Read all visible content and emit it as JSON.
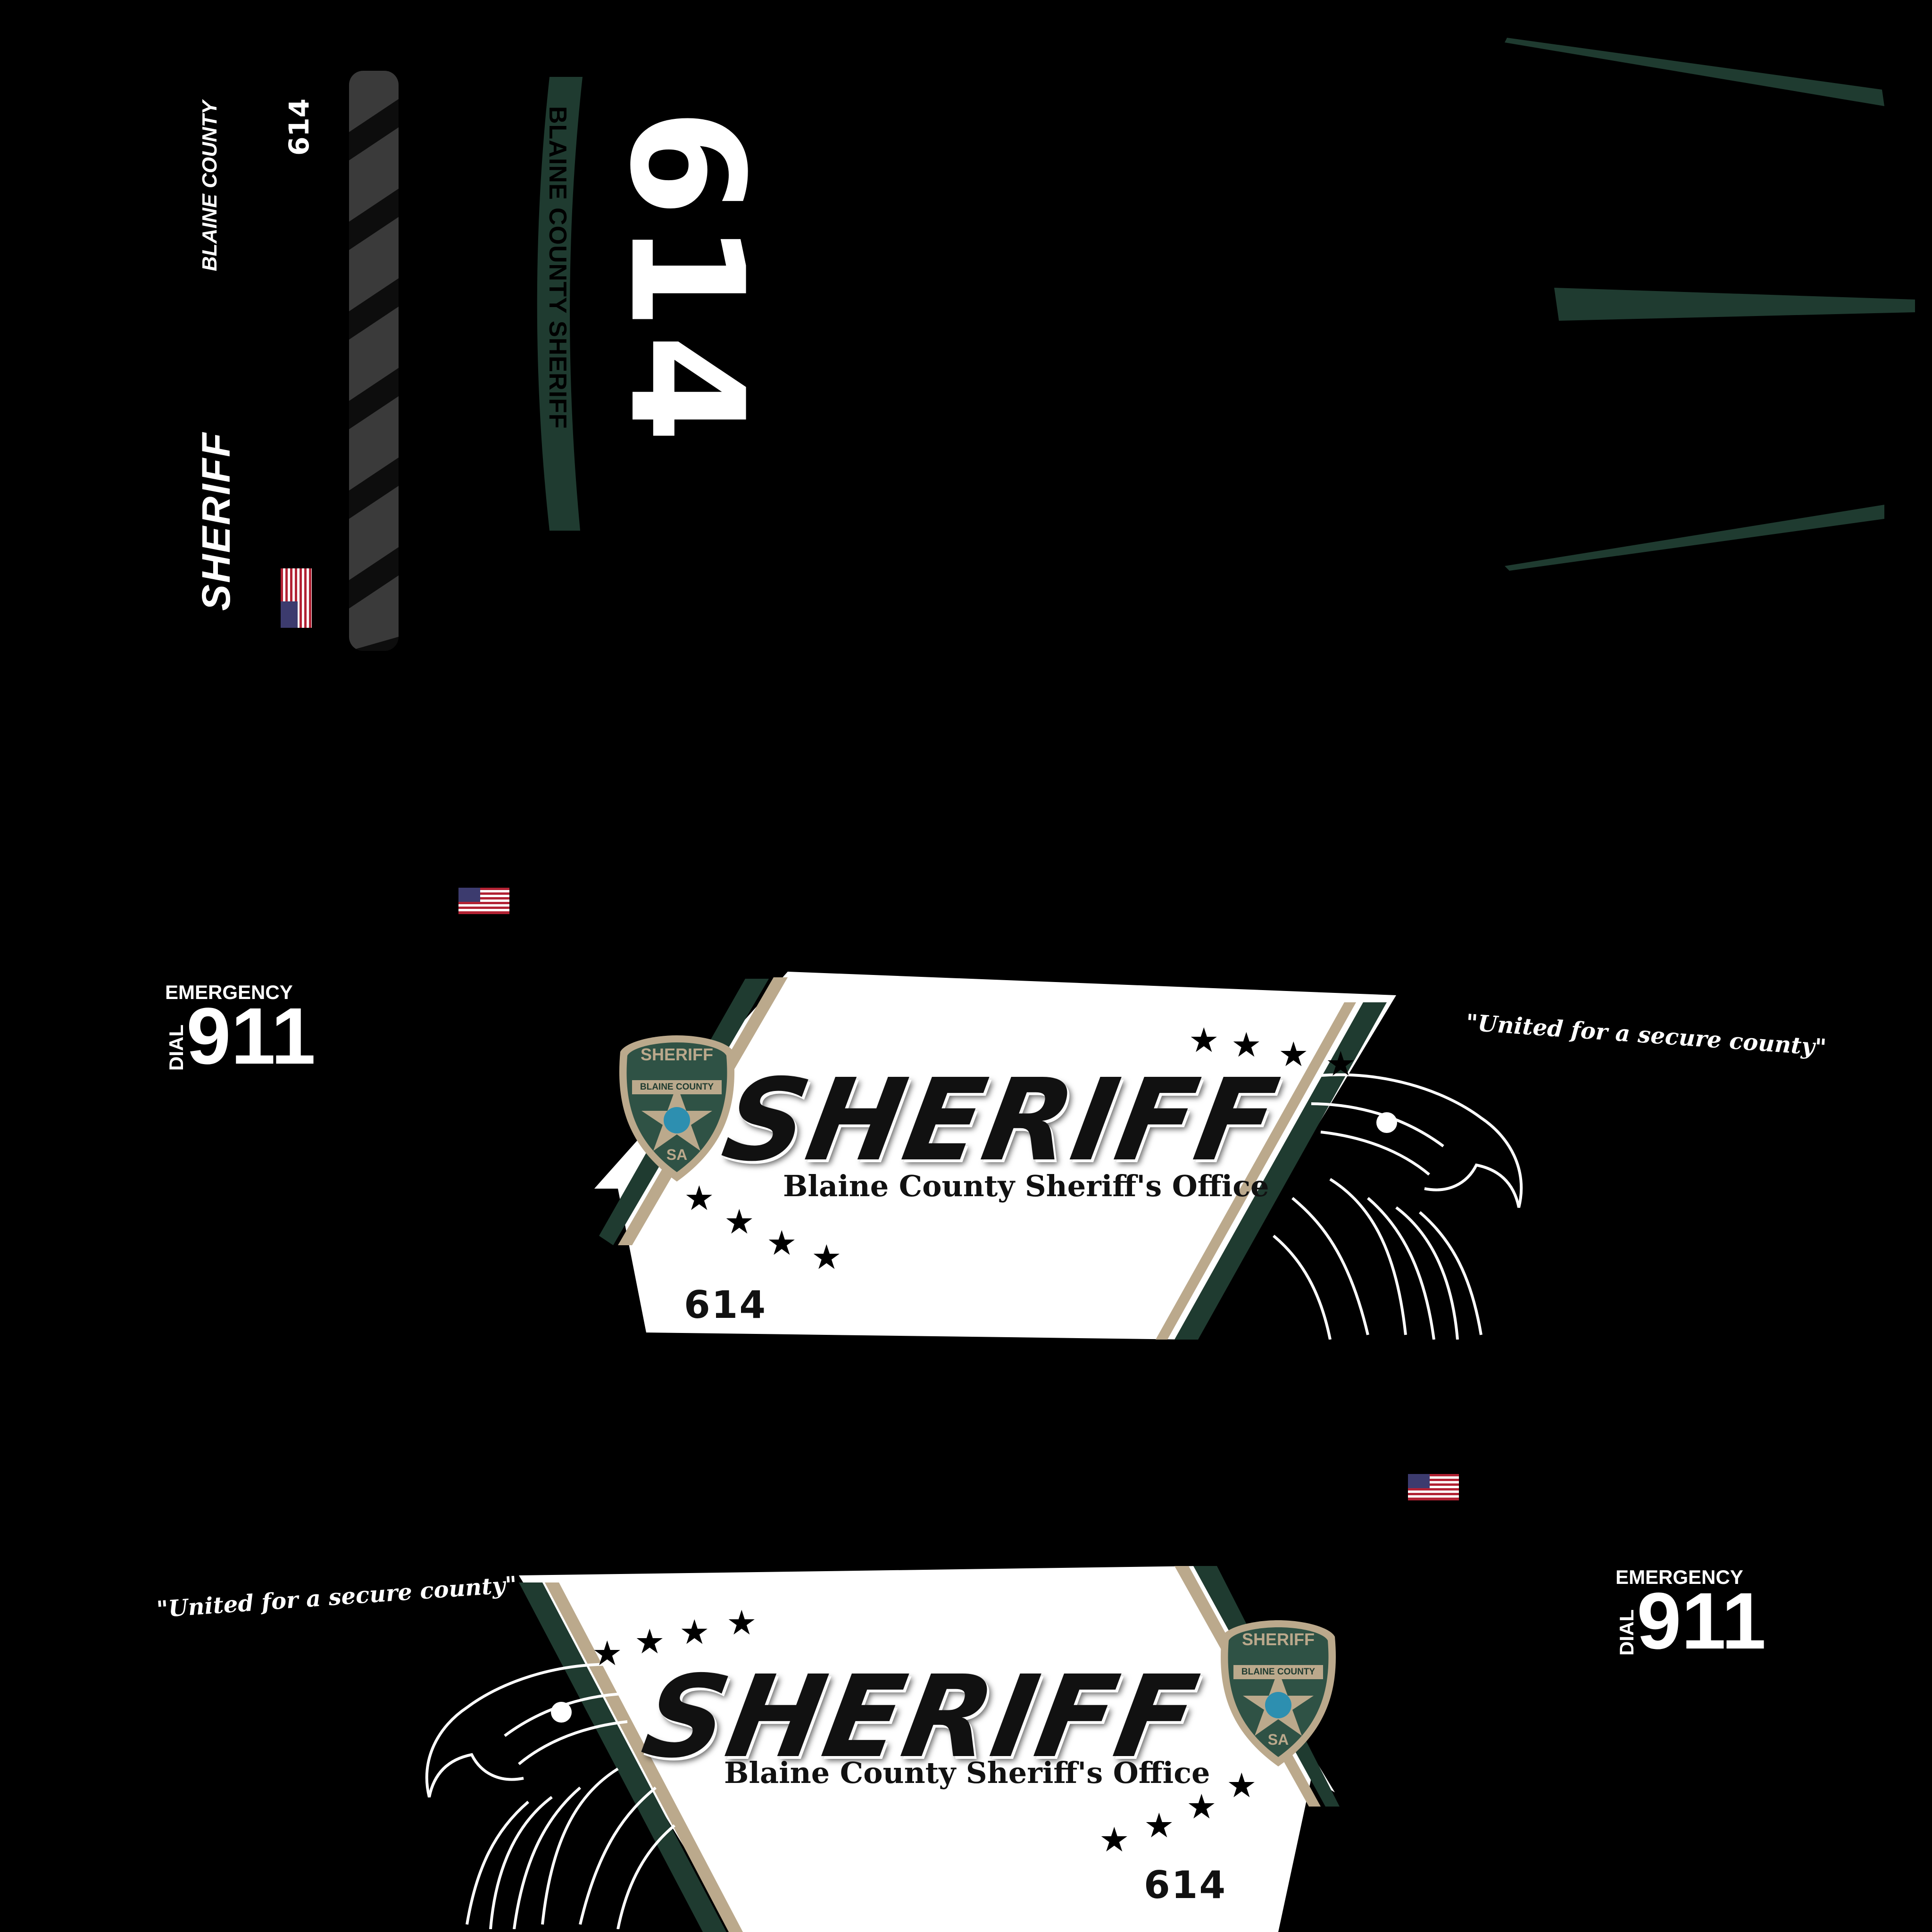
{
  "texts": {
    "roof_blaine_county": "BLAINE COUNTY",
    "roof_sheriff": "SHERIFF",
    "roof_number_small": "614",
    "hood_arc": "BLAINE COUNTY SHERIFF",
    "hood_number_big": "614",
    "emergency": "EMERGENCY",
    "dial": "DIAL",
    "phone": "911",
    "slogan": "\"United for a secure county\"",
    "sheriff": "SHERIFF",
    "office": "Blaine County Sheriff's Office",
    "unit_number": "614",
    "badge_top": "SHERIFF",
    "badge_ribbon": "BLAINE COUNTY",
    "badge_bottom": "SA"
  },
  "colors": {
    "background": "#000000",
    "green": "#1f3b30",
    "tan": "#bba98c",
    "white_panel": "#ffffff",
    "text_dark": "#111111"
  },
  "icons": [
    "us-flag-icon",
    "sheriff-badge-icon",
    "eagle-head-icon",
    "star-icon"
  ]
}
